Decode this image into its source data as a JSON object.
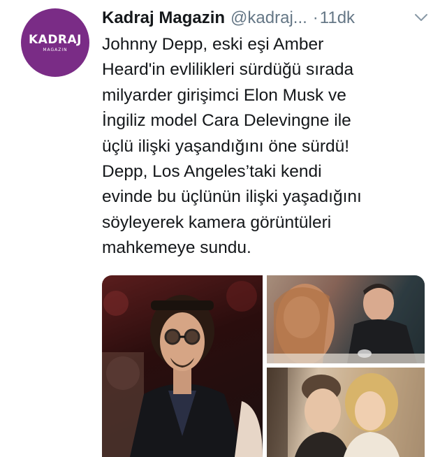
{
  "tweet": {
    "display_name": "Kadraj Magazin",
    "handle": "@kadraj...",
    "separator": "·",
    "time": "11dk",
    "text_lines": [
      "Johnny Depp, eski eşi Amber",
      "Heard'in evlilikleri sürdüğü sırada",
      "milyarder girişimci Elon Musk ve",
      "İngiliz model Cara Delevingne ile",
      "üçlü ilişki yaşandığını öne sürdü!",
      "Depp, Los Angeles’taki kendi",
      "evinde bu üçlünün ilişki yaşadığını",
      "söyleyerek kamera görüntüleri",
      "mahkemeye sundu."
    ]
  },
  "avatar": {
    "logo_text": "KADRAJ",
    "logo_sub": "MAGAZIN",
    "background_color": "#7a2c86"
  },
  "icons": {
    "more_menu": "chevron-down-icon"
  },
  "colors": {
    "text_primary": "#14171a",
    "text_secondary": "#657786"
  }
}
